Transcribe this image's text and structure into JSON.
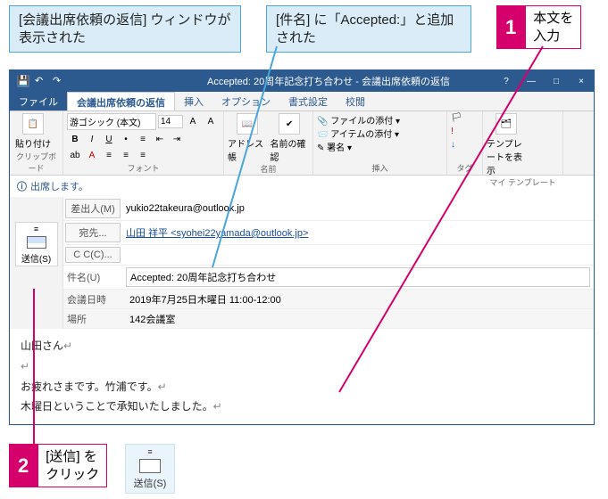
{
  "callouts": {
    "c1": "[会議出席依頼の返信] ウィンドウが表示された",
    "c2": "[件名] に「Accepted:」と追加された",
    "s1_num": "1",
    "s1_txt": "本文を\n入力",
    "s2_num": "2",
    "s2_txt": "[送信] を\nクリック"
  },
  "titlebar": {
    "title": "Accepted: 20周年記念打ち合わせ - 会議出席依頼の返信",
    "min": "—",
    "max": "□",
    "close": "×",
    "help": "?"
  },
  "tabs": {
    "file": "ファイル",
    "active": "会議出席依頼の返信",
    "insert": "挿入",
    "option": "オプション",
    "format": "書式設定",
    "review": "校閲"
  },
  "ribbon": {
    "clipboard_label": "クリップボード",
    "paste": "貼り付け",
    "font_label": "フォント",
    "font_name": "游ゴシック (本文)",
    "font_size": "14",
    "names_label": "名前",
    "addr": "アドレス帳",
    "chk": "名前の確認",
    "insert_label": "挿入",
    "attach": "ファイルの添付",
    "item": "アイテムの添付",
    "sig": "署名",
    "tags_label": "タグ",
    "tpl_label": "マイ テンプレート",
    "tpl_btn": "テンプレートを表示"
  },
  "info": {
    "icon": "ⓘ",
    "text": "出席します。"
  },
  "send": {
    "label": "送信(S)",
    "label2": "送信(S)"
  },
  "fields": {
    "from_lbl": "差出人(M)",
    "from_val": "yukio22takeura@outlook.jp",
    "to_lbl": "宛先...",
    "to_val": "山田 祥平 <syohei22yamada@outlook.jp>",
    "cc_lbl": "C C(C)...",
    "cc_val": "",
    "subj_lbl": "件名(U)",
    "subj_val": "Accepted: 20周年記念打ち合わせ",
    "when_lbl": "会議日時",
    "when_val": "2019年7月25日木曜日 11:00-12:00",
    "where_lbl": "場所",
    "where_val": "142会議室"
  },
  "body": {
    "l1": "山田さん",
    "l2": "お疲れさまです。竹浦です。",
    "l3": "木曜日ということで承知いたしました。"
  },
  "colors": {
    "accent": "#2c5a8f",
    "magenta": "#d6006c",
    "callout": "#4aa5dd"
  }
}
